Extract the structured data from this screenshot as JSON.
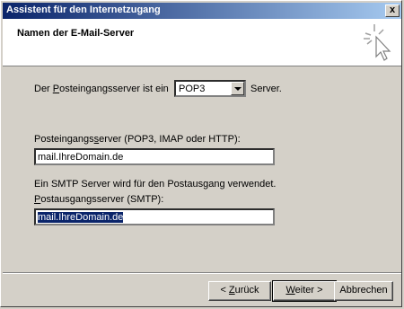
{
  "window": {
    "title": "Assistent für den Internetzugang",
    "close_glyph": "x"
  },
  "header": {
    "title": "Namen der E-Mail-Server",
    "icon": "wizard-sparkle-cursor-icon"
  },
  "incoming_type": {
    "label_prefix": "Der ",
    "label_underlined": "P",
    "label_rest": "osteingangsserver ist ein",
    "selected": "POP3",
    "suffix": "Server."
  },
  "incoming_server": {
    "label_prefix": "Posteingangs",
    "label_underlined": "s",
    "label_rest": "erver (POP3, IMAP oder HTTP):",
    "value": "mail.IhreDomain.de"
  },
  "outgoing_server": {
    "info": "Ein SMTP Server wird für den Postausgang verwendet.",
    "label_underlined": "P",
    "label_rest": "ostausgangsserver (SMTP):",
    "value": "mail.IhreDomain.de"
  },
  "buttons": {
    "back_prefix": "< ",
    "back_underlined": "Z",
    "back_rest": "urück",
    "next_underlined": "W",
    "next_rest": "eiter >",
    "cancel": "Abbrechen"
  }
}
